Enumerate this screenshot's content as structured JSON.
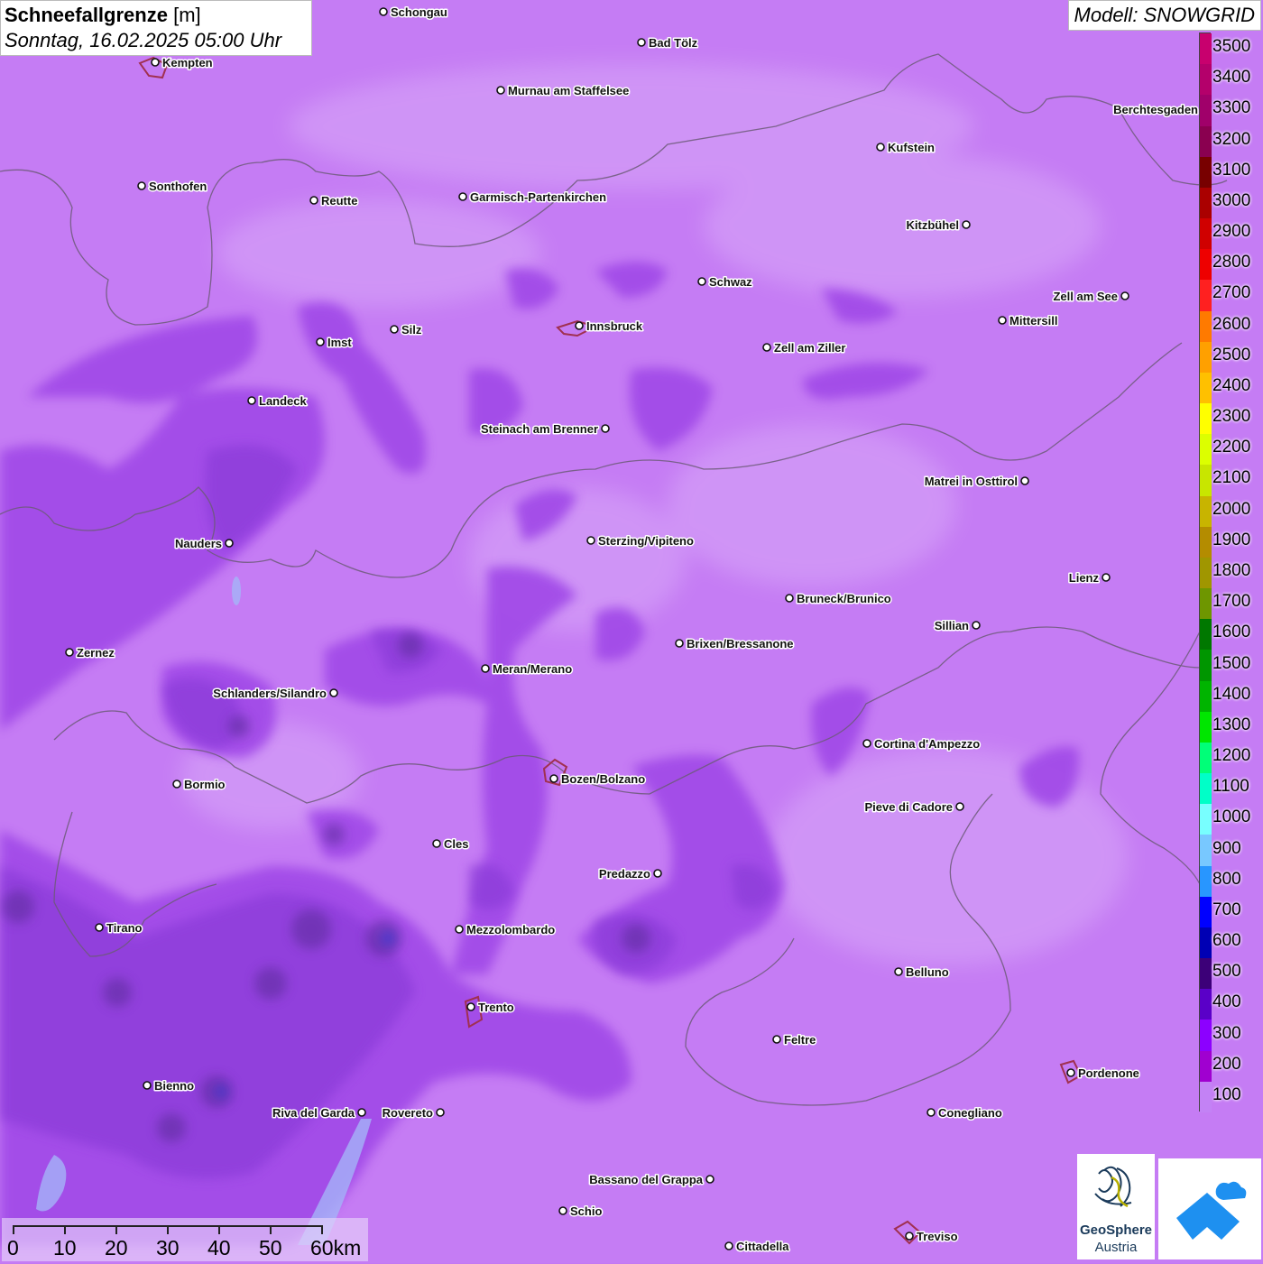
{
  "title": {
    "main": "Schneefallgrenze",
    "unit": "[m]",
    "datetime": "Sonntag, 16.02.2025 05:00 Uhr"
  },
  "model": {
    "label": "Modell: SNOWGRID"
  },
  "legend": {
    "items": [
      {
        "value": "3500",
        "color": "#c8006e"
      },
      {
        "value": "3400",
        "color": "#b4006b"
      },
      {
        "value": "3300",
        "color": "#a0006a"
      },
      {
        "value": "3200",
        "color": "#8a0050"
      },
      {
        "value": "3100",
        "color": "#780000"
      },
      {
        "value": "3000",
        "color": "#aa0000"
      },
      {
        "value": "2900",
        "color": "#d00000"
      },
      {
        "value": "2800",
        "color": "#ee0000"
      },
      {
        "value": "2700",
        "color": "#ff2020"
      },
      {
        "value": "2600",
        "color": "#ff7a00"
      },
      {
        "value": "2500",
        "color": "#ffa000"
      },
      {
        "value": "2400",
        "color": "#ffc000"
      },
      {
        "value": "2300",
        "color": "#ffff00"
      },
      {
        "value": "2200",
        "color": "#dcff00"
      },
      {
        "value": "2100",
        "color": "#c8e600"
      },
      {
        "value": "2000",
        "color": "#c8b400"
      },
      {
        "value": "1900",
        "color": "#b48c00"
      },
      {
        "value": "1800",
        "color": "#a09600"
      },
      {
        "value": "1700",
        "color": "#6e9600"
      },
      {
        "value": "1600",
        "color": "#007800"
      },
      {
        "value": "1500",
        "color": "#009600"
      },
      {
        "value": "1400",
        "color": "#00b400"
      },
      {
        "value": "1300",
        "color": "#00e600"
      },
      {
        "value": "1200",
        "color": "#00ff78"
      },
      {
        "value": "1100",
        "color": "#00ffc8"
      },
      {
        "value": "1000",
        "color": "#78ffff"
      },
      {
        "value": "900",
        "color": "#78c8ff"
      },
      {
        "value": "800",
        "color": "#2896ff"
      },
      {
        "value": "700",
        "color": "#0000ff"
      },
      {
        "value": "600",
        "color": "#0000b4"
      },
      {
        "value": "500",
        "color": "#3c0078"
      },
      {
        "value": "400",
        "color": "#5a00c8"
      },
      {
        "value": "300",
        "color": "#8c00ff"
      },
      {
        "value": "200",
        "color": "#a000d0"
      },
      {
        "value": "100",
        "color": "#c382f5"
      }
    ]
  },
  "scale": {
    "labels": [
      "0",
      "10",
      "20",
      "30",
      "40",
      "50",
      "60km"
    ]
  },
  "logos": {
    "geosphere_line1": "GeoSphere",
    "geosphere_line2": "Austria"
  },
  "cities": [
    {
      "name": "Schongau"
    },
    {
      "name": "Kempten"
    },
    {
      "name": "Bad Tölz"
    },
    {
      "name": "Murnau am Staffelsee"
    },
    {
      "name": "Berchtesgaden"
    },
    {
      "name": "Kufstein"
    },
    {
      "name": "Sonthofen"
    },
    {
      "name": "Reutte"
    },
    {
      "name": "Garmisch-Partenkirchen"
    },
    {
      "name": "Kitzbühel"
    },
    {
      "name": "Schwaz"
    },
    {
      "name": "Zell am See"
    },
    {
      "name": "Innsbruck"
    },
    {
      "name": "Mittersill"
    },
    {
      "name": "Silz"
    },
    {
      "name": "Imst"
    },
    {
      "name": "Zell am Ziller"
    },
    {
      "name": "Landeck"
    },
    {
      "name": "Steinach am Brenner"
    },
    {
      "name": "Matrei in Osttirol"
    },
    {
      "name": "Nauders"
    },
    {
      "name": "Sterzing/Vipiteno"
    },
    {
      "name": "Lienz"
    },
    {
      "name": "Bruneck/Brunico"
    },
    {
      "name": "Sillian"
    },
    {
      "name": "Brixen/Bressanone"
    },
    {
      "name": "Zernez"
    },
    {
      "name": "Meran/Merano"
    },
    {
      "name": "Schlanders/Silandro"
    },
    {
      "name": "Cortina d'Ampezzo"
    },
    {
      "name": "Bozen/Bolzano"
    },
    {
      "name": "Bormio"
    },
    {
      "name": "Pieve di Cadore"
    },
    {
      "name": "Cles"
    },
    {
      "name": "Predazzo"
    },
    {
      "name": "Tirano"
    },
    {
      "name": "Mezzolombardo"
    },
    {
      "name": "Belluno"
    },
    {
      "name": "Trento"
    },
    {
      "name": "Feltre"
    },
    {
      "name": "Pordenone"
    },
    {
      "name": "Bienno"
    },
    {
      "name": "Riva del Garda"
    },
    {
      "name": "Rovereto"
    },
    {
      "name": "Conegliano"
    },
    {
      "name": "Bassano del Grappa"
    },
    {
      "name": "Schio"
    },
    {
      "name": "Treviso"
    },
    {
      "name": "Cittadella"
    }
  ]
}
